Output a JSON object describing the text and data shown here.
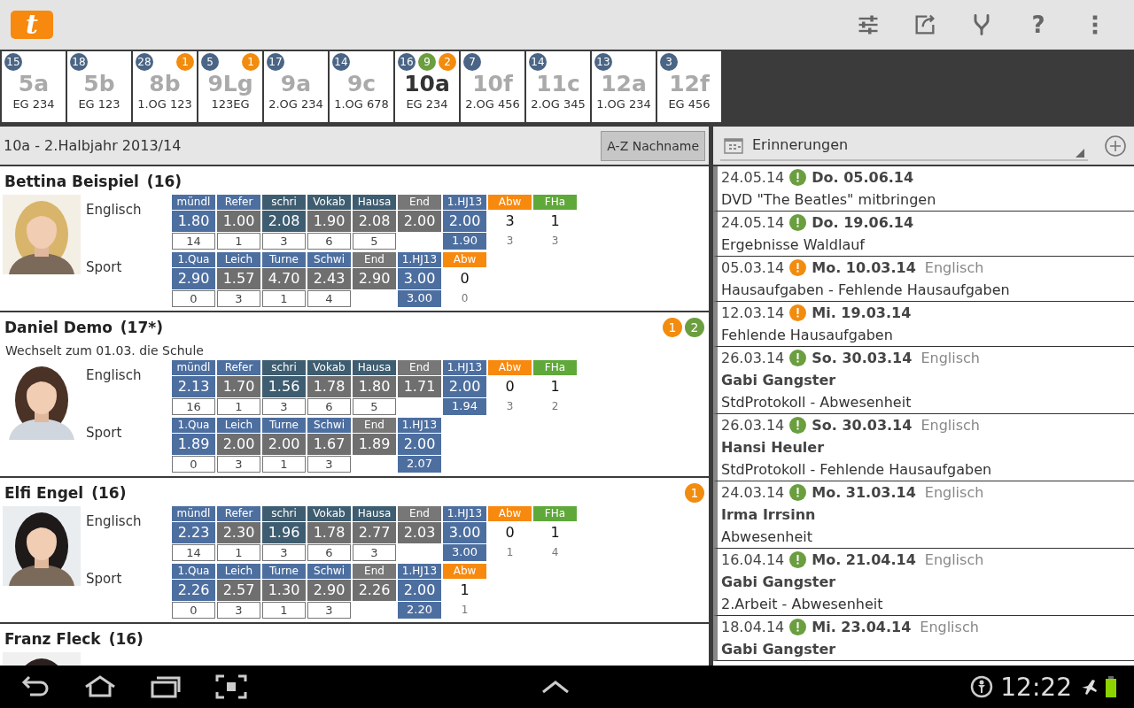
{
  "app_bar": {
    "logo_text": "t",
    "help": "?"
  },
  "classes": [
    {
      "label": "5a",
      "room": "EG 234",
      "selected": false,
      "badges": [
        {
          "text": "15",
          "color": "#4a6585"
        }
      ]
    },
    {
      "label": "5b",
      "room": "EG 123",
      "selected": false,
      "badges": [
        {
          "text": "18",
          "color": "#4a6585"
        }
      ]
    },
    {
      "label": "8b",
      "room": "1.OG 123",
      "selected": false,
      "badges": [
        {
          "text": "28",
          "color": "#4a6585"
        },
        {
          "text": "1",
          "color": "#f28c0f"
        }
      ]
    },
    {
      "label": "9Lg",
      "room": "123EG",
      "selected": false,
      "badges": [
        {
          "text": "5",
          "color": "#4a6585"
        },
        {
          "text": "1",
          "color": "#f28c0f"
        }
      ]
    },
    {
      "label": "9a",
      "room": "2.OG 234",
      "selected": false,
      "badges": [
        {
          "text": "17",
          "color": "#4a6585"
        }
      ]
    },
    {
      "label": "9c",
      "room": "1.OG 678",
      "selected": false,
      "badges": [
        {
          "text": "14",
          "color": "#4a6585"
        }
      ]
    },
    {
      "label": "10a",
      "room": "EG 234",
      "selected": true,
      "badges": [
        {
          "text": "16",
          "color": "#4a6585"
        },
        {
          "text": "9",
          "color": "#6b9e3f"
        },
        {
          "text": "2",
          "color": "#f28c0f"
        }
      ]
    },
    {
      "label": "10f",
      "room": "2.OG 456",
      "selected": false,
      "badges": [
        {
          "text": "7",
          "color": "#4a6585"
        }
      ]
    },
    {
      "label": "11c",
      "room": "2.OG 345",
      "selected": false,
      "badges": [
        {
          "text": "14",
          "color": "#4a6585"
        }
      ]
    },
    {
      "label": "12a",
      "room": "1.OG 234",
      "selected": false,
      "badges": [
        {
          "text": "13",
          "color": "#4a6585"
        }
      ]
    },
    {
      "label": "12f",
      "room": "EG 456",
      "selected": false,
      "badges": [
        {
          "text": "3",
          "color": "#4a6585"
        }
      ]
    }
  ],
  "class_header": {
    "title": "10a - 2.Halbjahr 2013/14",
    "sort_button": "A-Z Nachname"
  },
  "students": [
    {
      "name": "Bettina Beispiel",
      "count": "(16)",
      "subjects": [
        {
          "name": "Englisch",
          "columns": [
            {
              "kind": "grade",
              "header": {
                "text": "mündl",
                "color": "#4d6fa0"
              },
              "value": {
                "text": "1.80",
                "color": "#4d6fa0"
              },
              "count": "14"
            },
            {
              "kind": "grade",
              "header": {
                "text": "Refer",
                "color": "#4d6fa0"
              },
              "value": {
                "text": "1.00",
                "color": "#6f6f6f"
              },
              "count": "1"
            },
            {
              "kind": "grade",
              "header": {
                "text": "schri",
                "color": "#3e5d70"
              },
              "value": {
                "text": "2.08",
                "color": "#3e5d70"
              },
              "count": "3"
            },
            {
              "kind": "grade",
              "header": {
                "text": "Vokab",
                "color": "#3e5d70"
              },
              "value": {
                "text": "1.90",
                "color": "#6f6f6f"
              },
              "count": "6"
            },
            {
              "kind": "grade",
              "header": {
                "text": "Hausa",
                "color": "#3e5d70"
              },
              "value": {
                "text": "2.08",
                "color": "#6f6f6f"
              },
              "count": "5"
            },
            {
              "kind": "end",
              "header": {
                "text": "End",
                "color": "#777777"
              },
              "value": {
                "text": "2.00",
                "color": "#6f6f6f"
              }
            },
            {
              "kind": "total",
              "header": {
                "text": "1.HJ13",
                "color": "#4d6fa0"
              },
              "value": {
                "text": "2.00",
                "color": "#4d6fa0"
              },
              "count": "1.90"
            },
            {
              "kind": "tally",
              "header": {
                "text": "Abw",
                "color": "#f7890f"
              },
              "value": {
                "text": "3"
              },
              "count": "3"
            },
            {
              "kind": "tally",
              "header": {
                "text": "FHa",
                "color": "#5fa83a"
              },
              "value": {
                "text": "1"
              },
              "count": "3"
            }
          ]
        },
        {
          "name": "Sport",
          "columns": [
            {
              "kind": "grade",
              "header": {
                "text": "1.Qua",
                "color": "#4d6fa0"
              },
              "value": {
                "text": "2.90",
                "color": "#4d6fa0"
              },
              "count": "0"
            },
            {
              "kind": "grade",
              "header": {
                "text": "Leich",
                "color": "#4d6fa0"
              },
              "value": {
                "text": "1.57",
                "color": "#6f6f6f"
              },
              "count": "3"
            },
            {
              "kind": "grade",
              "header": {
                "text": "Turne",
                "color": "#4d6fa0"
              },
              "value": {
                "text": "4.70",
                "color": "#6f6f6f"
              },
              "count": "1"
            },
            {
              "kind": "grade",
              "header": {
                "text": "Schwi",
                "color": "#4d6fa0"
              },
              "value": {
                "text": "2.43",
                "color": "#6f6f6f"
              },
              "count": "4"
            },
            {
              "kind": "end",
              "header": {
                "text": "End",
                "color": "#777777"
              },
              "value": {
                "text": "2.90",
                "color": "#6f6f6f"
              }
            },
            {
              "kind": "total",
              "header": {
                "text": "1.HJ13",
                "color": "#4d6fa0"
              },
              "value": {
                "text": "3.00",
                "color": "#4d6fa0"
              },
              "count": "3.00"
            },
            {
              "kind": "tally",
              "header": {
                "text": "Abw",
                "color": "#f7890f"
              },
              "value": {
                "text": "0"
              },
              "count": "0"
            }
          ]
        }
      ]
    },
    {
      "name": "Daniel Demo",
      "count": "(17*)",
      "note": "Wechselt zum 01.03. die Schule",
      "badges": [
        {
          "text": "1",
          "color": "#f28c0f"
        },
        {
          "text": "2",
          "color": "#6b9e3f"
        }
      ],
      "subjects": [
        {
          "name": "Englisch",
          "columns": [
            {
              "kind": "grade",
              "header": {
                "text": "mündl",
                "color": "#4d6fa0"
              },
              "value": {
                "text": "2.13",
                "color": "#4d6fa0"
              },
              "count": "16"
            },
            {
              "kind": "grade",
              "header": {
                "text": "Refer",
                "color": "#4d6fa0"
              },
              "value": {
                "text": "1.70",
                "color": "#6f6f6f"
              },
              "count": "1"
            },
            {
              "kind": "grade",
              "header": {
                "text": "schri",
                "color": "#3e5d70"
              },
              "value": {
                "text": "1.56",
                "color": "#3e5d70"
              },
              "count": "3"
            },
            {
              "kind": "grade",
              "header": {
                "text": "Vokab",
                "color": "#3e5d70"
              },
              "value": {
                "text": "1.78",
                "color": "#6f6f6f"
              },
              "count": "6"
            },
            {
              "kind": "grade",
              "header": {
                "text": "Hausa",
                "color": "#3e5d70"
              },
              "value": {
                "text": "1.80",
                "color": "#6f6f6f"
              },
              "count": "5"
            },
            {
              "kind": "end",
              "header": {
                "text": "End",
                "color": "#777777"
              },
              "value": {
                "text": "1.71",
                "color": "#6f6f6f"
              }
            },
            {
              "kind": "total",
              "header": {
                "text": "1.HJ13",
                "color": "#4d6fa0"
              },
              "value": {
                "text": "2.00",
                "color": "#4d6fa0"
              },
              "count": "1.94"
            },
            {
              "kind": "tally",
              "header": {
                "text": "Abw",
                "color": "#f7890f"
              },
              "value": {
                "text": "0"
              },
              "count": "3"
            },
            {
              "kind": "tally",
              "header": {
                "text": "FHa",
                "color": "#5fa83a"
              },
              "value": {
                "text": "1"
              },
              "count": "2"
            }
          ]
        },
        {
          "name": "Sport",
          "columns": [
            {
              "kind": "grade",
              "header": {
                "text": "1.Qua",
                "color": "#4d6fa0"
              },
              "value": {
                "text": "1.89",
                "color": "#4d6fa0"
              },
              "count": "0"
            },
            {
              "kind": "grade",
              "header": {
                "text": "Leich",
                "color": "#4d6fa0"
              },
              "value": {
                "text": "2.00",
                "color": "#6f6f6f"
              },
              "count": "3"
            },
            {
              "kind": "grade",
              "header": {
                "text": "Turne",
                "color": "#4d6fa0"
              },
              "value": {
                "text": "2.00",
                "color": "#6f6f6f"
              },
              "count": "1"
            },
            {
              "kind": "grade",
              "header": {
                "text": "Schwi",
                "color": "#4d6fa0"
              },
              "value": {
                "text": "1.67",
                "color": "#6f6f6f"
              },
              "count": "3"
            },
            {
              "kind": "end",
              "header": {
                "text": "End",
                "color": "#777777"
              },
              "value": {
                "text": "1.89",
                "color": "#6f6f6f"
              }
            },
            {
              "kind": "total",
              "header": {
                "text": "1.HJ13",
                "color": "#4d6fa0"
              },
              "value": {
                "text": "2.00",
                "color": "#4d6fa0"
              },
              "count": "2.07"
            }
          ]
        }
      ]
    },
    {
      "name": "Elfi Engel",
      "count": "(16)",
      "badges": [
        {
          "text": "1",
          "color": "#f28c0f"
        }
      ],
      "subjects": [
        {
          "name": "Englisch",
          "columns": [
            {
              "kind": "grade",
              "header": {
                "text": "mündl",
                "color": "#4d6fa0"
              },
              "value": {
                "text": "2.23",
                "color": "#4d6fa0"
              },
              "count": "14"
            },
            {
              "kind": "grade",
              "header": {
                "text": "Refer",
                "color": "#4d6fa0"
              },
              "value": {
                "text": "2.30",
                "color": "#6f6f6f"
              },
              "count": "1"
            },
            {
              "kind": "grade",
              "header": {
                "text": "schri",
                "color": "#3e5d70"
              },
              "value": {
                "text": "1.96",
                "color": "#3e5d70"
              },
              "count": "3"
            },
            {
              "kind": "grade",
              "header": {
                "text": "Vokab",
                "color": "#3e5d70"
              },
              "value": {
                "text": "1.78",
                "color": "#6f6f6f"
              },
              "count": "6"
            },
            {
              "kind": "grade",
              "header": {
                "text": "Hausa",
                "color": "#3e5d70"
              },
              "value": {
                "text": "2.77",
                "color": "#6f6f6f"
              },
              "count": "3"
            },
            {
              "kind": "end",
              "header": {
                "text": "End",
                "color": "#777777"
              },
              "value": {
                "text": "2.03",
                "color": "#6f6f6f"
              }
            },
            {
              "kind": "total",
              "header": {
                "text": "1.HJ13",
                "color": "#4d6fa0"
              },
              "value": {
                "text": "3.00",
                "color": "#4d6fa0"
              },
              "count": "3.00"
            },
            {
              "kind": "tally",
              "header": {
                "text": "Abw",
                "color": "#f7890f"
              },
              "value": {
                "text": "0"
              },
              "count": "1"
            },
            {
              "kind": "tally",
              "header": {
                "text": "FHa",
                "color": "#5fa83a"
              },
              "value": {
                "text": "1"
              },
              "count": "4"
            }
          ]
        },
        {
          "name": "Sport",
          "columns": [
            {
              "kind": "grade",
              "header": {
                "text": "1.Qua",
                "color": "#4d6fa0"
              },
              "value": {
                "text": "2.26",
                "color": "#4d6fa0"
              },
              "count": "0"
            },
            {
              "kind": "grade",
              "header": {
                "text": "Leich",
                "color": "#4d6fa0"
              },
              "value": {
                "text": "2.57",
                "color": "#6f6f6f"
              },
              "count": "3"
            },
            {
              "kind": "grade",
              "header": {
                "text": "Turne",
                "color": "#4d6fa0"
              },
              "value": {
                "text": "1.30",
                "color": "#6f6f6f"
              },
              "count": "1"
            },
            {
              "kind": "grade",
              "header": {
                "text": "Schwi",
                "color": "#4d6fa0"
              },
              "value": {
                "text": "2.90",
                "color": "#6f6f6f"
              },
              "count": "3"
            },
            {
              "kind": "end",
              "header": {
                "text": "End",
                "color": "#777777"
              },
              "value": {
                "text": "2.26",
                "color": "#6f6f6f"
              }
            },
            {
              "kind": "total",
              "header": {
                "text": "1.HJ13",
                "color": "#4d6fa0"
              },
              "value": {
                "text": "2.00",
                "color": "#4d6fa0"
              },
              "count": "2.20"
            },
            {
              "kind": "tally",
              "header": {
                "text": "Abw",
                "color": "#f7890f"
              },
              "value": {
                "text": "1"
              },
              "count": "1"
            }
          ]
        }
      ]
    },
    {
      "name": "Franz Fleck",
      "count": "(16)"
    }
  ],
  "reminders_header": {
    "title": "Erinnerungen"
  },
  "reminders": [
    {
      "created": "24.05.14",
      "color": "#6a9e3f",
      "due": "Do. 05.06.14",
      "text": "DVD \"The Beatles\" mitbringen"
    },
    {
      "created": "24.05.14",
      "color": "#6a9e3f",
      "due": "Do. 19.06.14",
      "text": "Ergebnisse Waldlauf"
    },
    {
      "created": "05.03.14",
      "color": "#f28c0f",
      "due": "Mo. 10.03.14",
      "subject": "Englisch",
      "text": "Hausaufgaben - Fehlende Hausaufgaben"
    },
    {
      "created": "12.03.14",
      "color": "#f28c0f",
      "due": "Mi. 19.03.14",
      "text": "Fehlende Hausaufgaben"
    },
    {
      "created": "26.03.14",
      "color": "#6a9e3f",
      "due": "So. 30.03.14",
      "subject": "Englisch",
      "person": "Gabi Gangster",
      "text": "StdProtokoll - Abwesenheit"
    },
    {
      "created": "26.03.14",
      "color": "#6a9e3f",
      "due": "So. 30.03.14",
      "subject": "Englisch",
      "person": "Hansi Heuler",
      "text": "StdProtokoll - Fehlende Hausaufgaben"
    },
    {
      "created": "24.03.14",
      "color": "#6a9e3f",
      "due": "Mo. 31.03.14",
      "subject": "Englisch",
      "person": "Irma Irrsinn",
      "text": "Abwesenheit"
    },
    {
      "created": "16.04.14",
      "color": "#6a9e3f",
      "due": "Mo. 21.04.14",
      "subject": "Englisch",
      "person": "Gabi Gangster",
      "text": "2.Arbeit - Abwesenheit"
    },
    {
      "created": "18.04.14",
      "color": "#6a9e3f",
      "due": "Mi. 23.04.14",
      "subject": "Englisch",
      "person": "Gabi Gangster"
    }
  ],
  "status_bar": {
    "time": "12:22"
  }
}
